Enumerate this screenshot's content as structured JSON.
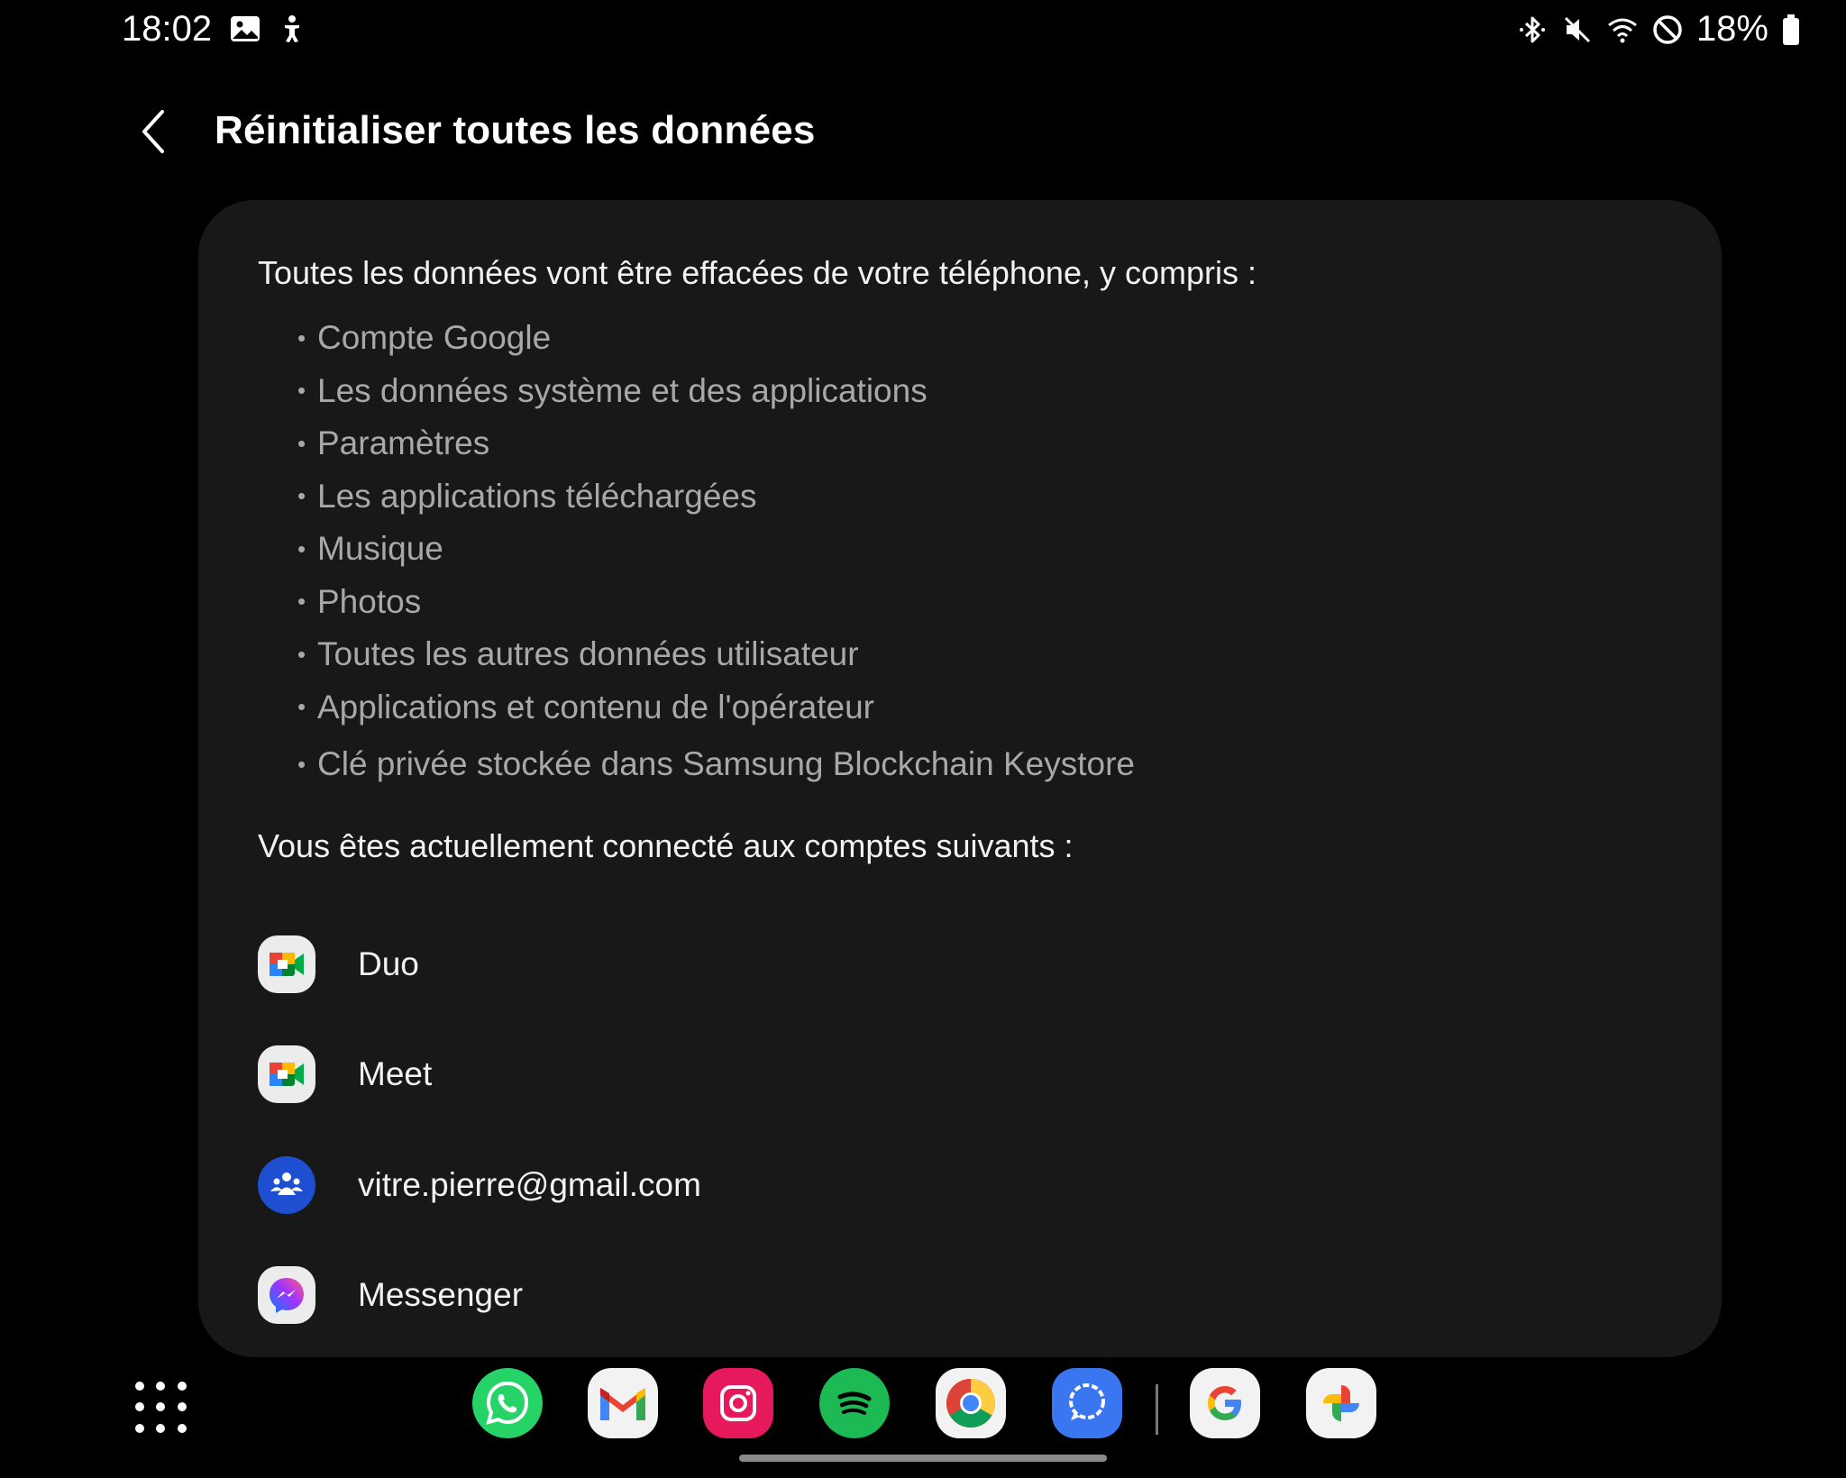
{
  "status_bar": {
    "time": "18:02",
    "battery_percent": "18%",
    "left_icons": [
      "gallery-icon",
      "accessibility-icon"
    ],
    "right_icons": [
      "bluetooth-icon",
      "mute-icon",
      "wifi-icon",
      "do-not-disturb-icon",
      "battery-icon"
    ]
  },
  "header": {
    "title": "Réinitialiser toutes les données",
    "back_icon": "chevron-left-icon"
  },
  "content": {
    "intro": "Toutes les données vont être effacées de votre téléphone, y compris :",
    "bullet": "•",
    "items": [
      "Compte Google",
      "Les données système et des applications",
      "Paramètres",
      "Les applications téléchargées",
      "Musique",
      "Photos",
      "Toutes les autres données utilisateur",
      "Applications et contenu de l'opérateur",
      "Clé privée stockée dans Samsung Blockchain Keystore"
    ],
    "accounts_intro": "Vous êtes actuellement connecté aux comptes suivants :",
    "accounts": [
      {
        "label": "Duo",
        "icon": "google-meet-icon"
      },
      {
        "label": "Meet",
        "icon": "google-meet-icon"
      },
      {
        "label": "vitre.pierre@gmail.com",
        "icon": "family-link-icon"
      },
      {
        "label": "Messenger",
        "icon": "messenger-icon"
      }
    ]
  },
  "dock": {
    "apps": [
      "whatsapp-icon",
      "gmail-icon",
      "instagram-icon",
      "spotify-icon",
      "chrome-icon",
      "signal-icon",
      "google-icon",
      "google-photos-icon"
    ]
  },
  "colors": {
    "background": "#000000",
    "card": "#181818",
    "primary_text": "#f2f2f2",
    "secondary_text": "#a8a8a8"
  }
}
